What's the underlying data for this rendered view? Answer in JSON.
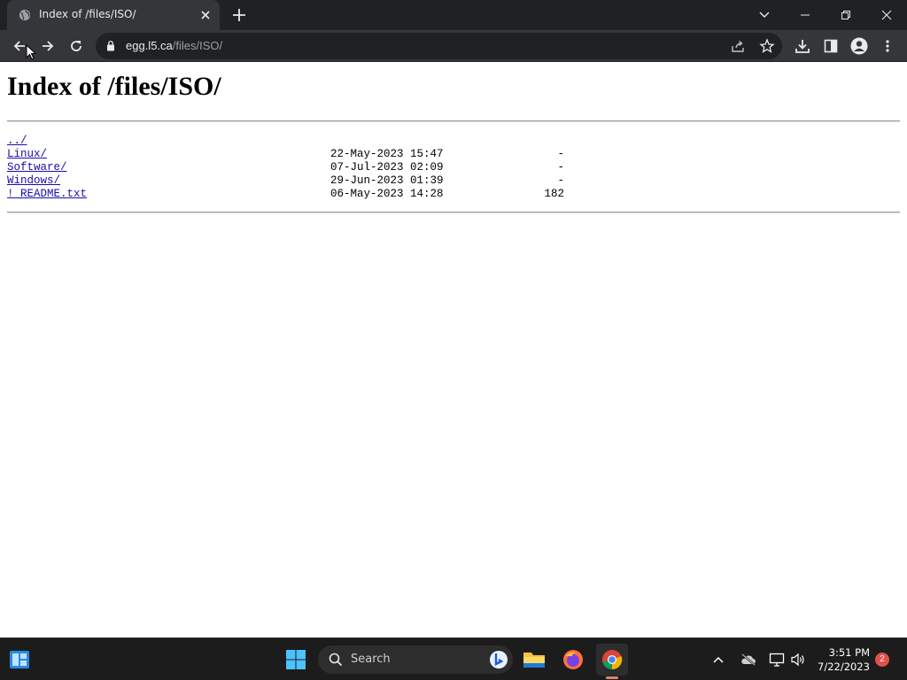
{
  "browser": {
    "tab_title": "Index of /files/ISO/",
    "url_host": "egg.l5.ca",
    "url_path": "/files/ISO/"
  },
  "page": {
    "heading": "Index of /files/ISO/",
    "entries": [
      {
        "name": "../",
        "date": "",
        "size": ""
      },
      {
        "name": "Linux/",
        "date": "22-May-2023 15:47",
        "size": "-"
      },
      {
        "name": "Software/",
        "date": "07-Jul-2023 02:09",
        "size": "-"
      },
      {
        "name": "Windows/",
        "date": "29-Jun-2023 01:39",
        "size": "-"
      },
      {
        "name": "! README.txt",
        "date": "06-May-2023 14:28",
        "size": "182"
      }
    ]
  },
  "taskbar": {
    "search_placeholder": "Search",
    "time": "3:51 PM",
    "date": "7/22/2023",
    "notification_count": "2"
  },
  "colors": {
    "chrome_dark": "#202124",
    "chrome_toolbar": "#35363a",
    "link": "#1a0dab",
    "taskbar": "#1c1c1c"
  }
}
